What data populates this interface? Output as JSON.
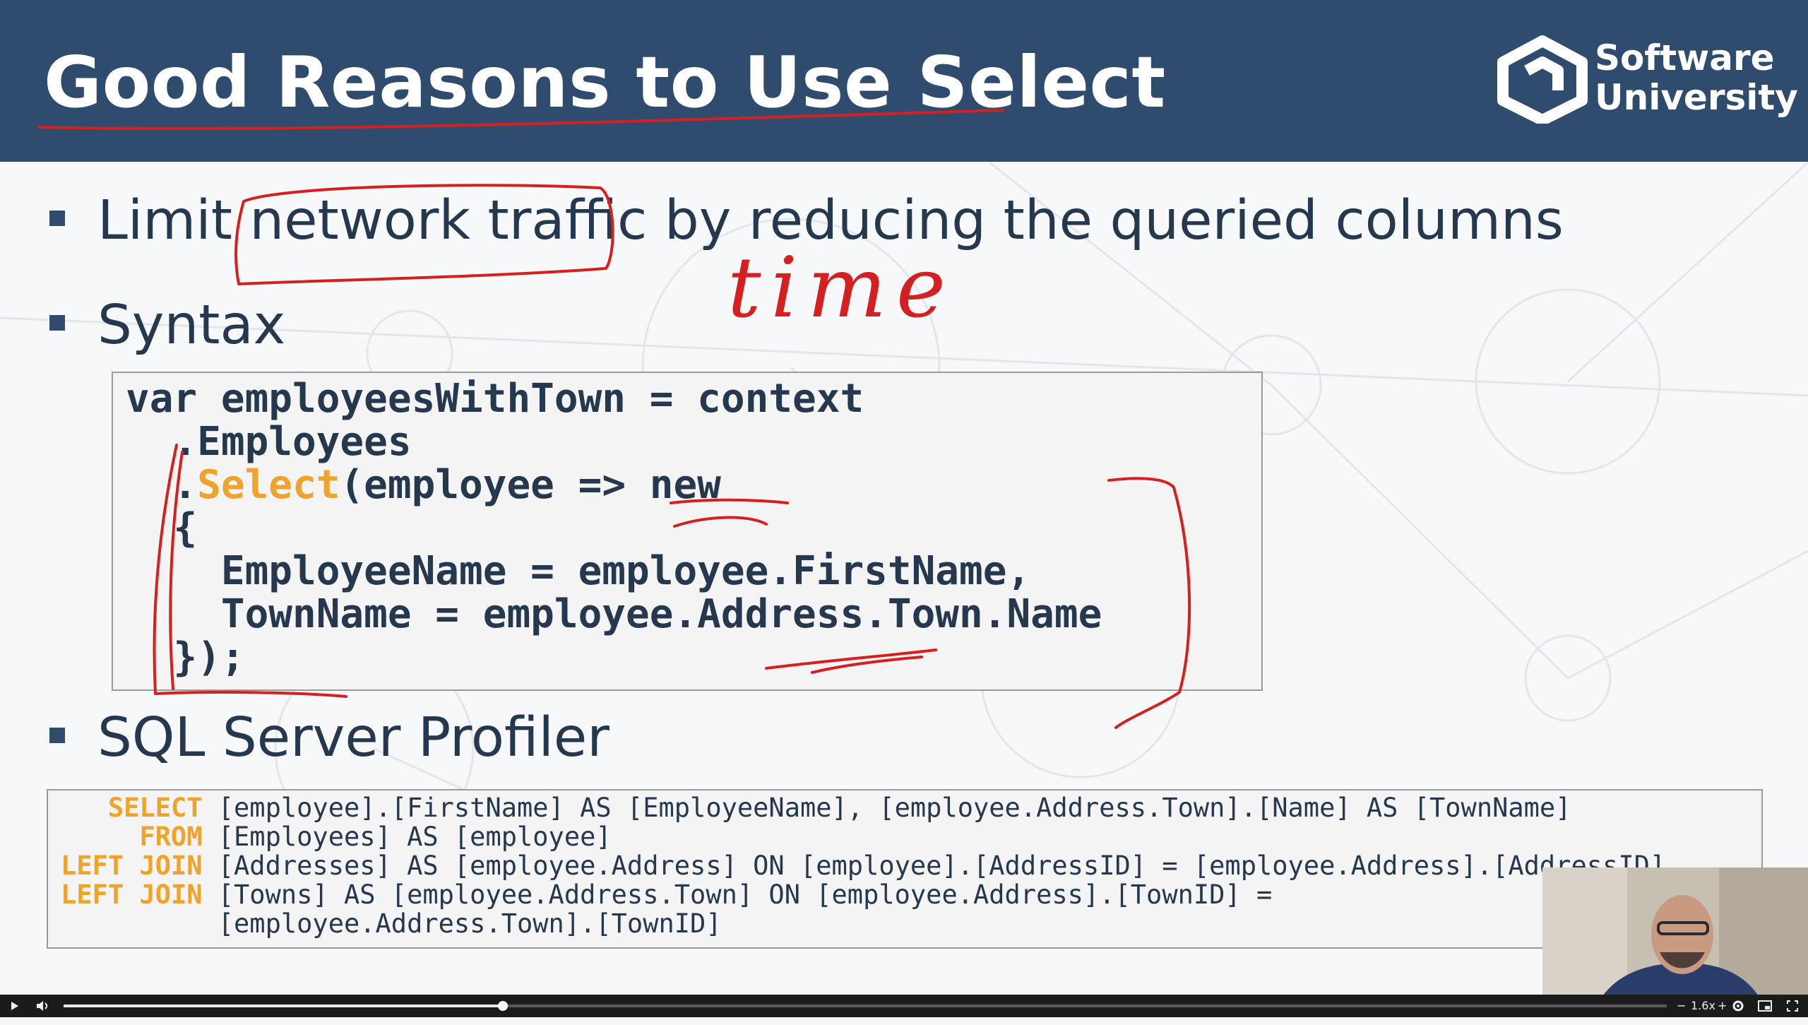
{
  "slide": {
    "title": "Good Reasons to Use Select",
    "logo": {
      "line1": "Software",
      "line2": "University"
    },
    "bullets": [
      {
        "text": "Limit network traffic by reducing the queried columns"
      },
      {
        "text": "Syntax"
      },
      {
        "text": "SQL Server Profiler"
      }
    ],
    "handwriting": "time",
    "code": {
      "line1": "var employeesWithTown = context",
      "line2": "  .Employees",
      "line3_pre": "  .",
      "line3_kw": "Select",
      "line3_post": "(employee => new",
      "line4": "  {",
      "line5": "    EmployeeName = employee.FirstName,",
      "line6": "    TownName = employee.Address.Town.Name",
      "line7": "  });"
    },
    "sql": [
      {
        "kw": "   SELECT",
        "text": " [employee].[FirstName] AS [EmployeeName], [employee.Address.Town].[Name] AS [TownName]"
      },
      {
        "kw": "     FROM",
        "text": " [Employees] AS [employee]"
      },
      {
        "kw": "LEFT JOIN",
        "text": " [Addresses] AS [employee.Address] ON [employee].[AddressID] = [employee.Address].[AddressID]"
      },
      {
        "kw": "LEFT JOIN",
        "text": " [Towns] AS [employee.Address.Town] ON [employee.Address].[TownID] ="
      },
      {
        "kw": "         ",
        "text": " [employee.Address.Town].[TownID]"
      }
    ]
  },
  "player": {
    "play_icon": "play-icon",
    "volume_icon": "volume-icon",
    "progress": 0.274,
    "speed": "1.6x",
    "settings_icon": "gear-icon",
    "pip_icon": "picture-in-picture-icon",
    "fullscreen_icon": "fullscreen-icon"
  },
  "colors": {
    "header": "#2f4c6e",
    "accent": "#f0a22a",
    "ink": "#d42020"
  }
}
